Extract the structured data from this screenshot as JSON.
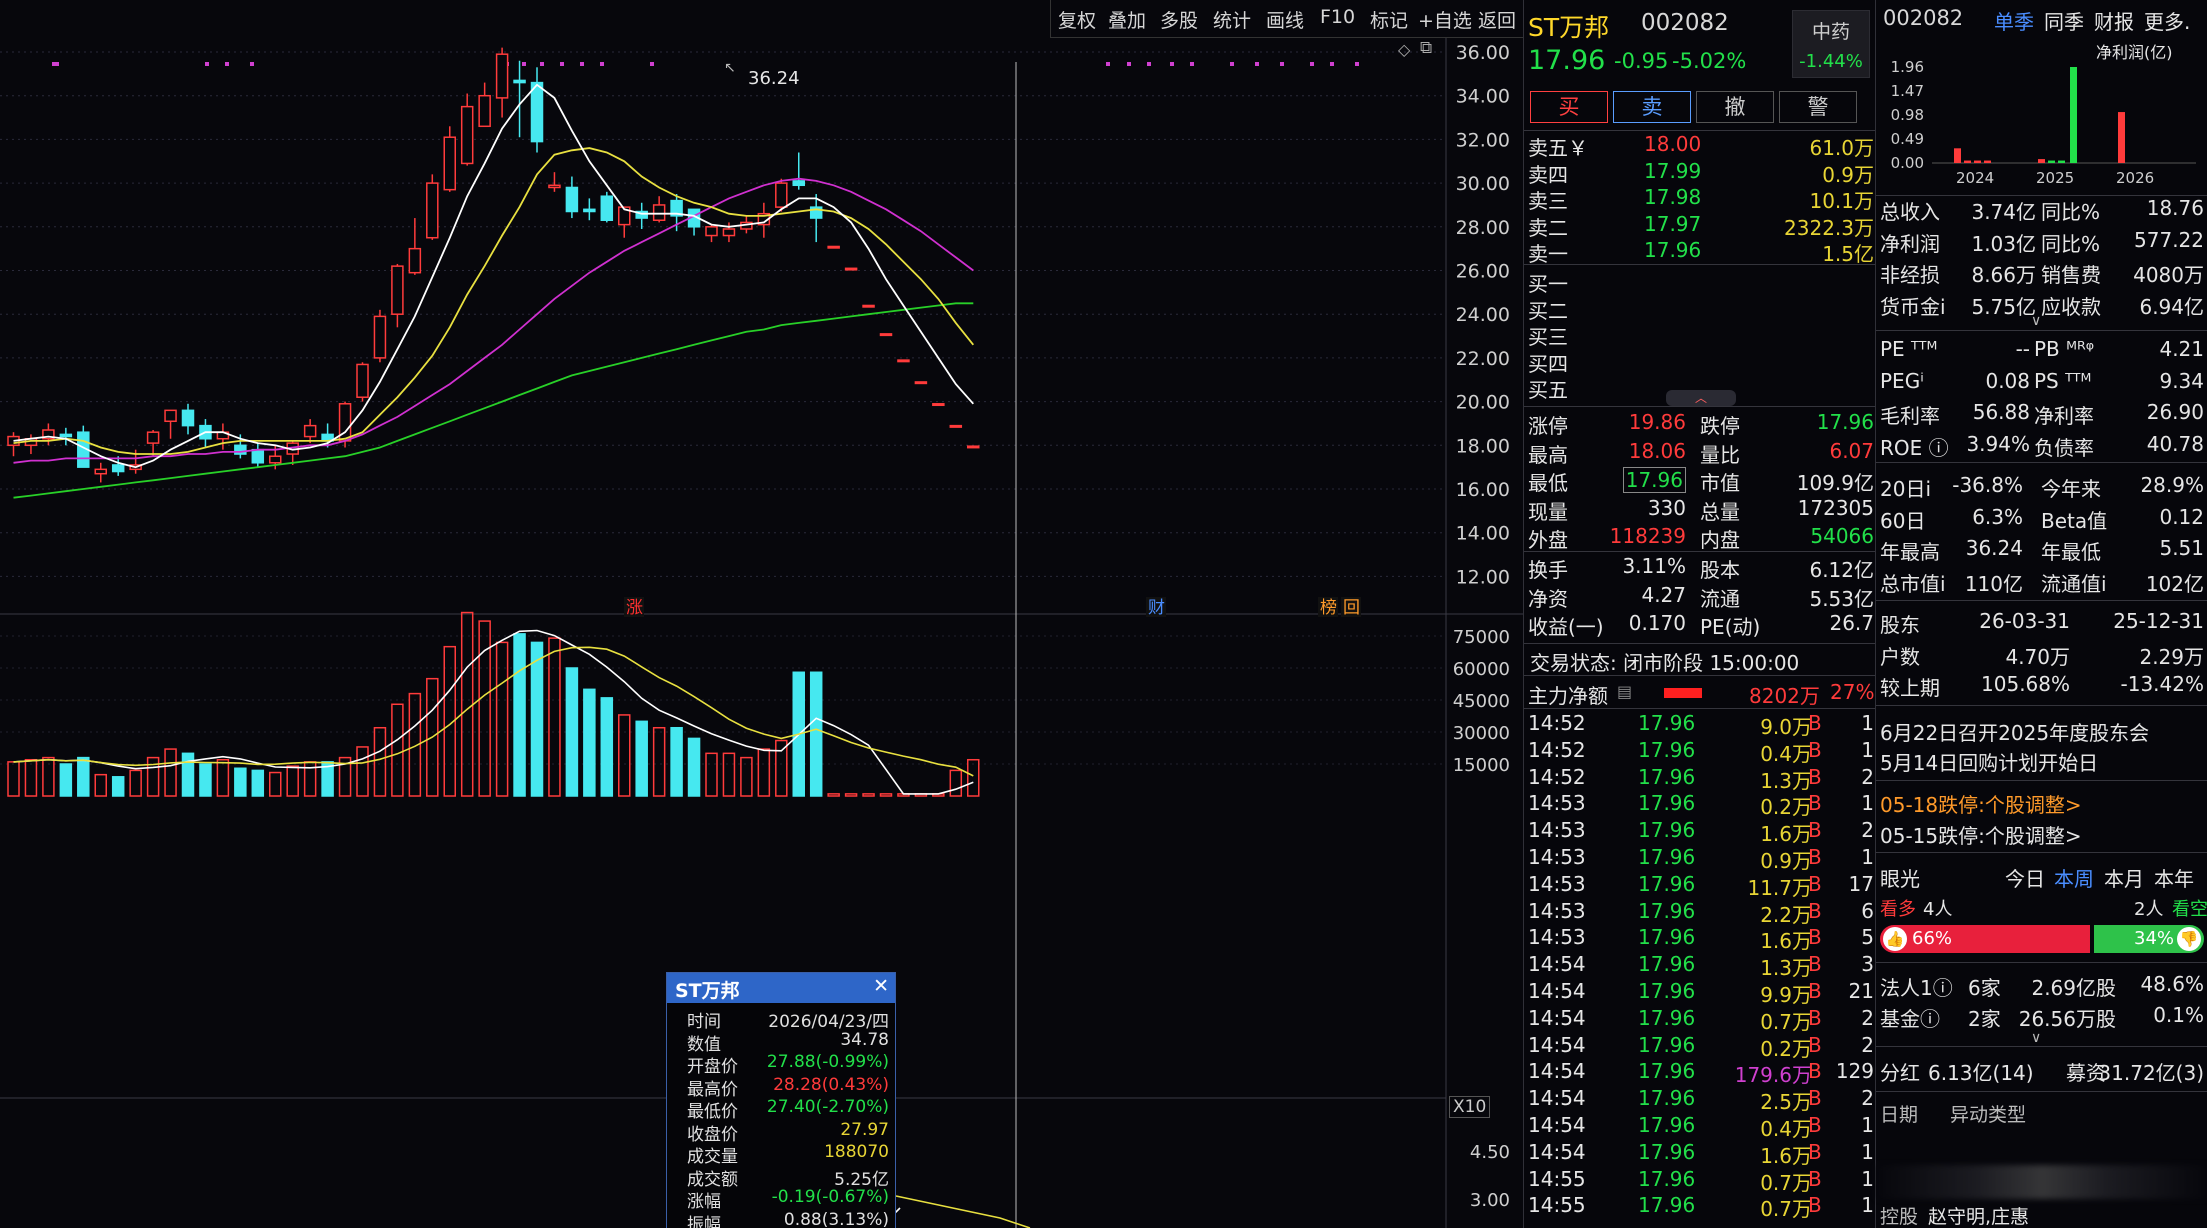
{
  "toolbar": {
    "items": [
      "复权",
      "叠加",
      "多股",
      "统计",
      "画线",
      "F10",
      "标记",
      "+自选",
      "返回"
    ]
  },
  "chart": {
    "price_axis": [
      "36.00",
      "34.00",
      "32.00",
      "30.00",
      "28.00",
      "26.00",
      "24.00",
      "22.00",
      "20.00",
      "18.00",
      "16.00",
      "14.00",
      "12.00"
    ],
    "volume_axis": [
      "75000",
      "60000",
      "45000",
      "30000",
      "15000"
    ],
    "volume_multiplier": "X10",
    "sub_axis": [
      "4.50",
      "3.00"
    ],
    "peak_label": "36.24",
    "event_markers": [
      "涨",
      "财",
      "榜",
      "回"
    ],
    "colors": {
      "up": "#ff3b3b",
      "down": "#46e8f0",
      "ma5": "#ffffff",
      "ma10": "#e8e040",
      "ma20": "#d030d0",
      "ma60": "#28d028"
    }
  },
  "chart_data": {
    "type": "candlestick",
    "ylim": [
      12,
      36
    ],
    "candles": [
      {
        "o": 18.0,
        "h": 18.6,
        "l": 17.5,
        "c": 18.4
      },
      {
        "o": 18.0,
        "h": 18.5,
        "l": 17.6,
        "c": 18.3
      },
      {
        "o": 18.3,
        "h": 19.0,
        "l": 18.0,
        "c": 18.7
      },
      {
        "o": 18.5,
        "h": 18.8,
        "l": 18.0,
        "c": 18.4
      },
      {
        "o": 18.6,
        "h": 18.9,
        "l": 17.2,
        "c": 17.0
      },
      {
        "o": 16.7,
        "h": 17.2,
        "l": 16.3,
        "c": 16.9
      },
      {
        "o": 17.1,
        "h": 17.5,
        "l": 16.6,
        "c": 16.8
      },
      {
        "o": 16.9,
        "h": 17.8,
        "l": 16.7,
        "c": 17.1
      },
      {
        "o": 18.1,
        "h": 18.7,
        "l": 17.5,
        "c": 18.6
      },
      {
        "o": 19.1,
        "h": 19.6,
        "l": 18.3,
        "c": 19.6
      },
      {
        "o": 19.6,
        "h": 19.9,
        "l": 18.5,
        "c": 18.9
      },
      {
        "o": 18.9,
        "h": 19.2,
        "l": 17.9,
        "c": 18.3
      },
      {
        "o": 18.3,
        "h": 19.0,
        "l": 17.8,
        "c": 18.6
      },
      {
        "o": 18.0,
        "h": 18.5,
        "l": 17.4,
        "c": 17.6
      },
      {
        "o": 17.8,
        "h": 18.1,
        "l": 17.0,
        "c": 17.2
      },
      {
        "o": 17.2,
        "h": 18.0,
        "l": 16.9,
        "c": 17.5
      },
      {
        "o": 17.6,
        "h": 18.2,
        "l": 17.1,
        "c": 18.1
      },
      {
        "o": 18.4,
        "h": 19.2,
        "l": 18.1,
        "c": 18.9
      },
      {
        "o": 18.5,
        "h": 19.0,
        "l": 17.9,
        "c": 18.2
      },
      {
        "o": 18.2,
        "h": 20.0,
        "l": 17.9,
        "c": 19.9
      },
      {
        "o": 20.2,
        "h": 21.8,
        "l": 20.0,
        "c": 21.7
      },
      {
        "o": 22.0,
        "h": 24.2,
        "l": 21.8,
        "c": 23.9
      },
      {
        "o": 24.0,
        "h": 26.3,
        "l": 23.4,
        "c": 26.2
      },
      {
        "o": 25.9,
        "h": 28.4,
        "l": 25.8,
        "c": 27.0
      },
      {
        "o": 27.5,
        "h": 30.4,
        "l": 27.4,
        "c": 30.0
      },
      {
        "o": 29.7,
        "h": 32.6,
        "l": 29.6,
        "c": 32.1
      },
      {
        "o": 30.9,
        "h": 34.1,
        "l": 30.8,
        "c": 33.5
      },
      {
        "o": 32.6,
        "h": 34.6,
        "l": 32.6,
        "c": 34.0
      },
      {
        "o": 33.9,
        "h": 36.2,
        "l": 33.0,
        "c": 35.9
      },
      {
        "o": 34.7,
        "h": 35.6,
        "l": 32.1,
        "c": 34.6
      },
      {
        "o": 34.6,
        "h": 35.3,
        "l": 31.4,
        "c": 31.9
      },
      {
        "o": 29.8,
        "h": 30.5,
        "l": 29.6,
        "c": 29.9
      },
      {
        "o": 29.8,
        "h": 30.3,
        "l": 28.4,
        "c": 28.7
      },
      {
        "o": 28.8,
        "h": 29.3,
        "l": 28.3,
        "c": 28.7
      },
      {
        "o": 29.4,
        "h": 29.6,
        "l": 28.2,
        "c": 28.3
      },
      {
        "o": 28.1,
        "h": 28.6,
        "l": 27.5,
        "c": 28.9
      },
      {
        "o": 28.7,
        "h": 29.1,
        "l": 27.9,
        "c": 28.4
      },
      {
        "o": 28.3,
        "h": 29.4,
        "l": 28.2,
        "c": 29.0
      },
      {
        "o": 29.2,
        "h": 29.5,
        "l": 27.8,
        "c": 28.5
      },
      {
        "o": 28.8,
        "h": 28.8,
        "l": 27.6,
        "c": 28.0
      },
      {
        "o": 27.6,
        "h": 28.1,
        "l": 27.3,
        "c": 28.0
      },
      {
        "o": 27.6,
        "h": 28.2,
        "l": 27.3,
        "c": 27.9
      },
      {
        "o": 27.9,
        "h": 28.5,
        "l": 27.7,
        "c": 28.2
      },
      {
        "o": 28.1,
        "h": 29.1,
        "l": 27.5,
        "c": 28.6
      },
      {
        "o": 28.9,
        "h": 30.2,
        "l": 28.7,
        "c": 30.0
      },
      {
        "o": 30.1,
        "h": 31.4,
        "l": 29.7,
        "c": 29.9
      },
      {
        "o": 28.9,
        "h": 29.5,
        "l": 27.3,
        "c": 28.4
      },
      {
        "o": 27.1,
        "h": 27.1,
        "l": 27.1,
        "c": 27.1
      },
      {
        "o": 26.1,
        "h": 26.1,
        "l": 26.1,
        "c": 26.1
      },
      {
        "o": 24.4,
        "h": 24.4,
        "l": 24.4,
        "c": 24.4
      },
      {
        "o": 23.1,
        "h": 23.1,
        "l": 23.1,
        "c": 23.1
      },
      {
        "o": 21.9,
        "h": 21.9,
        "l": 21.9,
        "c": 21.9
      },
      {
        "o": 20.9,
        "h": 20.9,
        "l": 20.9,
        "c": 20.9
      },
      {
        "o": 19.9,
        "h": 19.9,
        "l": 19.9,
        "c": 19.9
      },
      {
        "o": 18.9,
        "h": 18.9,
        "l": 18.9,
        "c": 18.9
      },
      {
        "o": 17.96,
        "h": 17.96,
        "l": 17.96,
        "c": 17.96
      }
    ],
    "volume": [
      16000,
      17000,
      18000,
      15000,
      18000,
      10000,
      9000,
      12000,
      18000,
      22000,
      20000,
      15000,
      17000,
      13000,
      12000,
      11000,
      14000,
      16000,
      16000,
      18000,
      23000,
      32000,
      43000,
      48000,
      55000,
      70000,
      86000,
      82000,
      72000,
      76000,
      72000,
      74000,
      60000,
      50000,
      46000,
      38000,
      35000,
      32000,
      32000,
      27000,
      20000,
      20000,
      18000,
      22000,
      26000,
      58000,
      58000,
      1000,
      1000,
      1000,
      1000,
      1000,
      1000,
      1000,
      12000,
      17000
    ],
    "ma5": [
      18.2,
      18.3,
      18.4,
      18.3,
      17.9,
      17.5,
      17.2,
      17.0,
      17.3,
      17.8,
      18.2,
      18.6,
      18.6,
      18.3,
      18.1,
      18.0,
      17.8,
      17.9,
      18.1,
      18.6,
      19.6,
      20.9,
      22.4,
      23.9,
      25.7,
      27.5,
      29.4,
      30.9,
      32.5,
      33.6,
      34.5,
      33.9,
      32.4,
      31.0,
      29.9,
      28.8,
      28.6,
      28.6,
      28.6,
      28.5,
      28.1,
      28.0,
      28.1,
      28.2,
      28.8,
      29.3,
      29.3,
      28.9,
      28.2,
      27.0,
      25.6,
      24.4,
      23.2,
      22.0,
      20.8,
      19.9
    ],
    "ma10": [
      18.1,
      18.2,
      18.2,
      18.3,
      18.2,
      17.9,
      17.7,
      17.6,
      17.6,
      17.6,
      17.7,
      17.9,
      18.1,
      18.2,
      18.2,
      18.2,
      18.2,
      18.2,
      18.2,
      18.3,
      18.6,
      19.4,
      20.2,
      21.1,
      22.1,
      23.4,
      24.9,
      26.2,
      27.6,
      28.9,
      30.4,
      31.3,
      31.5,
      31.6,
      31.4,
      31.0,
      30.3,
      29.8,
      29.4,
      29.1,
      28.9,
      28.6,
      28.5,
      28.5,
      28.6,
      28.7,
      28.8,
      28.7,
      28.4,
      27.9,
      27.2,
      26.4,
      25.6,
      24.7,
      23.6,
      22.6
    ],
    "ma20": [
      17.2,
      17.3,
      17.3,
      17.4,
      17.4,
      17.4,
      17.4,
      17.4,
      17.5,
      17.5,
      17.6,
      17.6,
      17.7,
      17.7,
      17.8,
      17.8,
      17.9,
      18.0,
      18.0,
      18.2,
      18.5,
      18.9,
      19.3,
      19.8,
      20.3,
      20.8,
      21.4,
      22.0,
      22.6,
      23.3,
      24.0,
      24.7,
      25.3,
      25.9,
      26.4,
      26.9,
      27.3,
      27.7,
      28.1,
      28.5,
      28.9,
      29.3,
      29.6,
      29.9,
      30.1,
      30.2,
      30.1,
      29.9,
      29.6,
      29.2,
      28.8,
      28.3,
      27.8,
      27.2,
      26.6,
      26.0
    ],
    "ma60": [
      15.6,
      15.7,
      15.8,
      15.9,
      16.0,
      16.1,
      16.2,
      16.3,
      16.4,
      16.5,
      16.6,
      16.7,
      16.8,
      16.9,
      17.0,
      17.1,
      17.2,
      17.3,
      17.4,
      17.5,
      17.7,
      17.9,
      18.2,
      18.5,
      18.8,
      19.1,
      19.4,
      19.7,
      20.0,
      20.3,
      20.6,
      20.9,
      21.2,
      21.4,
      21.6,
      21.8,
      22.0,
      22.2,
      22.4,
      22.6,
      22.8,
      23.0,
      23.2,
      23.3,
      23.5,
      23.6,
      23.7,
      23.8,
      23.9,
      24.0,
      24.1,
      24.2,
      24.3,
      24.4,
      24.5,
      24.5
    ]
  },
  "tooltip": {
    "title": "ST万邦",
    "rows": [
      {
        "k": "时间",
        "v": "2026/04/23/四",
        "c": "#e0e0e0"
      },
      {
        "k": "数值",
        "v": "34.78",
        "c": "#e0e0e0"
      },
      {
        "k": "开盘价",
        "v": "27.88(-0.99%)",
        "c": "#22e04a"
      },
      {
        "k": "最高价",
        "v": "28.28(0.43%)",
        "c": "#ff3b3b"
      },
      {
        "k": "最低价",
        "v": "27.40(-2.70%)",
        "c": "#22e04a"
      },
      {
        "k": "收盘价",
        "v": "27.97",
        "c": "#e8d535"
      },
      {
        "k": "成交量",
        "v": "188070",
        "c": "#e8d535"
      },
      {
        "k": "成交额",
        "v": "5.25亿",
        "c": "#e0e0e0"
      },
      {
        "k": "涨幅",
        "v": "-0.19(-0.67%)",
        "c": "#22e04a"
      },
      {
        "k": "振幅",
        "v": "0.88(3.13%)",
        "c": "#e0e0e0"
      }
    ]
  },
  "stock": {
    "name": "ST万邦",
    "code": "002082",
    "price": "17.96",
    "change": "-0.95",
    "pct": "-5.02%",
    "sector": "中药",
    "sector_pct": "-1.44%"
  },
  "trade_buttons": [
    "买",
    "卖",
    "撤",
    "警"
  ],
  "asks": [
    {
      "l": "卖五￥",
      "p": "18.00",
      "v": "61.0万",
      "pc": "#ff3b3b"
    },
    {
      "l": "卖四",
      "p": "17.99",
      "v": "0.9万",
      "pc": "#22e04a"
    },
    {
      "l": "卖三",
      "p": "17.98",
      "v": "10.1万",
      "pc": "#22e04a"
    },
    {
      "l": "卖二",
      "p": "17.97",
      "v": "2322.3万",
      "pc": "#22e04a"
    },
    {
      "l": "卖一",
      "p": "17.96",
      "v": "1.5亿",
      "pc": "#22e04a"
    }
  ],
  "bids": [
    "买一",
    "买二",
    "买三",
    "买四",
    "买五"
  ],
  "stats": [
    {
      "a": "涨停",
      "b": "19.86",
      "bc": "#ff3b3b",
      "c": "跌停",
      "d": "17.96",
      "dc": "#22e04a"
    },
    {
      "a": "最高",
      "b": "18.06",
      "bc": "#ff3b3b",
      "c": "量比",
      "d": "6.07",
      "dc": "#ff3b3b"
    },
    {
      "a": "最低",
      "b": "17.96",
      "bc": "#22e04a",
      "c": "市值",
      "d": "109.9亿",
      "dc": "#e6e6e6"
    },
    {
      "a": "现量",
      "b": "330",
      "bc": "#e6e6e6",
      "c": "总量",
      "d": "172305",
      "dc": "#e6e6e6"
    },
    {
      "a": "外盘",
      "b": "118239",
      "bc": "#ff3b3b",
      "c": "内盘",
      "d": "54066",
      "dc": "#22e04a"
    },
    {
      "a": "换手",
      "b": "3.11%",
      "bc": "#e6e6e6",
      "c": "股本",
      "d": "6.12亿",
      "dc": "#e6e6e6"
    },
    {
      "a": "净资",
      "b": "4.27",
      "bc": "#e6e6e6",
      "c": "流通",
      "d": "5.53亿",
      "dc": "#e6e6e6"
    },
    {
      "a": "收益(一)",
      "b": "0.170",
      "bc": "#e6e6e6",
      "c": "PE(动)",
      "d": "26.7",
      "dc": "#e6e6e6"
    }
  ],
  "trade_status": "交易状态: 闭市阶段 15:00:00",
  "main_flow": {
    "label": "主力净额",
    "value": "8202万",
    "pct": "27%"
  },
  "ticks": [
    {
      "t": "14:52",
      "p": "17.96",
      "v": "9.0万",
      "n": "1"
    },
    {
      "t": "14:52",
      "p": "17.96",
      "v": "0.4万",
      "n": "1"
    },
    {
      "t": "14:52",
      "p": "17.96",
      "v": "1.3万",
      "n": "2"
    },
    {
      "t": "14:53",
      "p": "17.96",
      "v": "0.2万",
      "n": "1"
    },
    {
      "t": "14:53",
      "p": "17.96",
      "v": "1.6万",
      "n": "2"
    },
    {
      "t": "14:53",
      "p": "17.96",
      "v": "0.9万",
      "n": "1"
    },
    {
      "t": "14:53",
      "p": "17.96",
      "v": "11.7万",
      "n": "17"
    },
    {
      "t": "14:53",
      "p": "17.96",
      "v": "2.2万",
      "n": "6"
    },
    {
      "t": "14:53",
      "p": "17.96",
      "v": "1.6万",
      "n": "5"
    },
    {
      "t": "14:54",
      "p": "17.96",
      "v": "1.3万",
      "n": "3"
    },
    {
      "t": "14:54",
      "p": "17.96",
      "v": "9.9万",
      "n": "21"
    },
    {
      "t": "14:54",
      "p": "17.96",
      "v": "0.7万",
      "n": "2"
    },
    {
      "t": "14:54",
      "p": "17.96",
      "v": "0.2万",
      "n": "2"
    },
    {
      "t": "14:54",
      "p": "17.96",
      "v": "179.6万",
      "n": "129"
    },
    {
      "t": "14:54",
      "p": "17.96",
      "v": "2.5万",
      "n": "2"
    },
    {
      "t": "14:54",
      "p": "17.96",
      "v": "0.4万",
      "n": "1"
    },
    {
      "t": "14:54",
      "p": "17.96",
      "v": "1.6万",
      "n": "1"
    },
    {
      "t": "14:55",
      "p": "17.96",
      "v": "0.7万",
      "n": "1"
    },
    {
      "t": "14:55",
      "p": "17.96",
      "v": "0.7万",
      "n": "1"
    }
  ],
  "tick_side": "B",
  "fin": {
    "code": "002082",
    "tabs": [
      "单季",
      "同季",
      "财报",
      "更多."
    ],
    "chart_axis": [
      "1.96",
      "1.47",
      "0.98",
      "0.49",
      "0.00"
    ],
    "chart_years": [
      "2024",
      "2025",
      "2026"
    ],
    "chart_label": "净利润(亿)",
    "bars": [
      {
        "v": 0.3,
        "c": "#ff3b3b"
      },
      {
        "v": 0.05,
        "c": "#ff3b3b"
      },
      {
        "v": 0.05,
        "c": "#ff3b3b"
      },
      {
        "v": 0.05,
        "c": "#ff3b3b"
      },
      {
        "v": 0.08,
        "c": "#ff3b3b"
      },
      {
        "v": 0.05,
        "c": "#22e04a"
      },
      {
        "v": 0.05,
        "c": "#22e04a"
      },
      {
        "v": 1.96,
        "c": "#22e04a"
      },
      {
        "v": 1.04,
        "c": "#ff3b3b"
      }
    ]
  },
  "fin_rows": [
    {
      "a": "总收入",
      "b": "3.74亿",
      "c": "同比%",
      "d": "18.76",
      "dc": "#e6e6e6"
    },
    {
      "a": "净利润",
      "b": "1.03亿",
      "c": "同比%",
      "d": "577.22",
      "dc": "#e6e6e6"
    },
    {
      "a": "非经损",
      "b": "8.66万",
      "c": "销售费",
      "d": "4080万",
      "dc": "#e6e6e6"
    },
    {
      "a": "货币金i",
      "b": "5.75亿",
      "c": "应收款",
      "d": "6.94亿",
      "dc": "#e6e6e6"
    }
  ],
  "val_rows": [
    {
      "a": "PE ᵀᵀᴹ",
      "b": "--",
      "c": "PB ᴹᴿᵠ",
      "d": "4.21"
    },
    {
      "a": "PEGⁱ",
      "b": "0.08",
      "c": "PS ᵀᵀᴹ",
      "d": "9.34"
    },
    {
      "a": "毛利率",
      "b": "56.88",
      "c": "净利率",
      "d": "26.90"
    },
    {
      "a": "ROE ⓘ",
      "b": "3.94%",
      "c": "负债率",
      "d": "40.78"
    }
  ],
  "perf_rows": [
    {
      "a": "20日i",
      "b": "-36.8%",
      "c": "今年来",
      "d": "28.9%"
    },
    {
      "a": "60日",
      "b": "6.3%",
      "c": "Beta值",
      "d": "0.12"
    },
    {
      "a": "年最高",
      "b": "36.24",
      "c": "年最低",
      "d": "5.51"
    },
    {
      "a": "总市值i",
      "b": "110亿",
      "c": "流通值i",
      "d": "102亿"
    }
  ],
  "holder_rows": [
    {
      "a": "股东",
      "b": "26-03-31",
      "d": "25-12-31"
    },
    {
      "a": "户数",
      "b": "4.70万",
      "d": "2.29万"
    },
    {
      "a": "较上期",
      "b": "105.68%",
      "d": "-13.42%"
    }
  ],
  "news": [
    "6月22日召开2025年度股东会",
    "5月14日回购计划开始日",
    "05-18跌停:个股调整>",
    "05-15跌停:个股调整>"
  ],
  "vision": {
    "label": "眼光",
    "tabs": [
      "今日",
      "本周",
      "本月",
      "本年"
    ],
    "bull_label": "看多",
    "bull_count": "4人",
    "bear_count": "2人",
    "bear_label": "看空",
    "bull_pct": "66%",
    "bear_pct": "34%"
  },
  "inst": [
    {
      "a": "法人1ⓘ",
      "b": "6家",
      "c": "2.69亿股",
      "d": "48.6%"
    },
    {
      "a": "基金ⓘ",
      "b": "2家",
      "c": "26.56万股",
      "d": "0.1%"
    }
  ],
  "dividend": {
    "a": "分红",
    "b": "6.13亿(14)",
    "c": "募资",
    "d": "31.72亿(3)"
  },
  "event_header": {
    "a": "日期",
    "b": "异动类型"
  },
  "control": {
    "a": "控股",
    "b": "赵守明,庄惠"
  }
}
